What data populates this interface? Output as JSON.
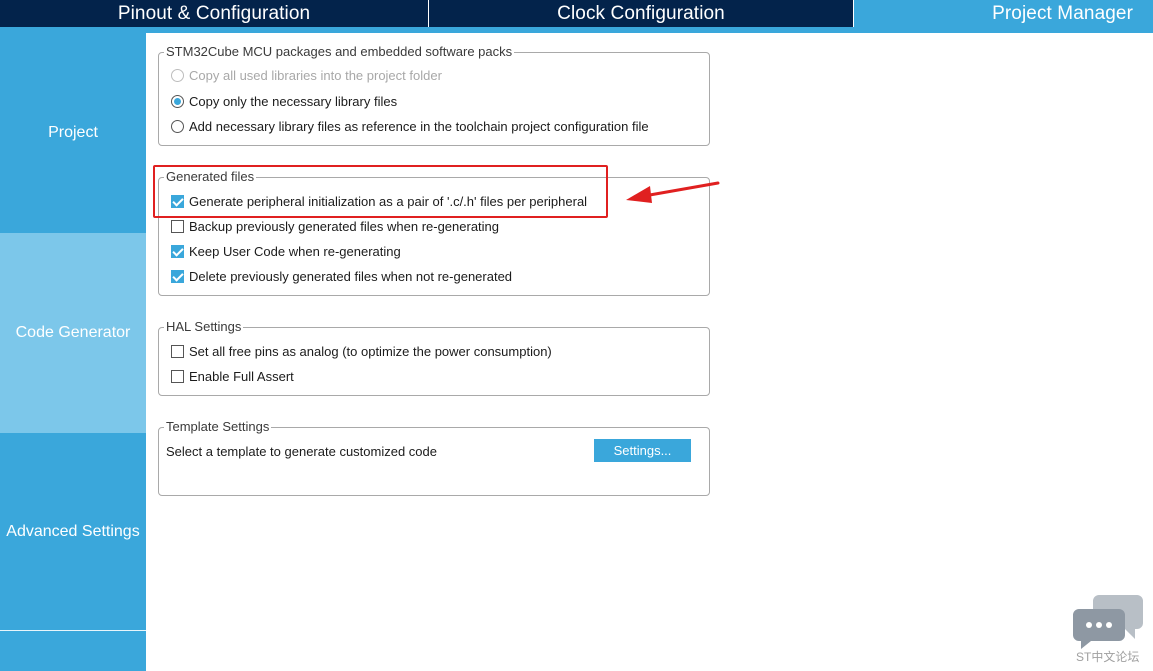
{
  "top_tabs": {
    "pinout": "Pinout & Configuration",
    "clock": "Clock Configuration",
    "project_manager": "Project Manager"
  },
  "sidebar": {
    "items": [
      {
        "label": "Project"
      },
      {
        "label": "Code Generator"
      },
      {
        "label": "Advanced Settings"
      }
    ]
  },
  "groups": {
    "packages": {
      "title": "STM32Cube MCU packages and embedded software packs",
      "options": [
        {
          "label": "Copy all used libraries into the project folder",
          "state": "disabled"
        },
        {
          "label": "Copy only the necessary library files",
          "state": "selected"
        },
        {
          "label": "Add necessary library files as reference in the toolchain project configuration file",
          "state": "unselected"
        }
      ]
    },
    "generated": {
      "title": "Generated files",
      "options": [
        {
          "label": "Generate peripheral initialization as a pair of '.c/.h' files per peripheral",
          "checked": true
        },
        {
          "label": "Backup previously generated files when re-generating",
          "checked": false
        },
        {
          "label": "Keep User Code when re-generating",
          "checked": true
        },
        {
          "label": "Delete previously generated files when not re-generated",
          "checked": true
        }
      ]
    },
    "hal": {
      "title": "HAL Settings",
      "options": [
        {
          "label": "Set all free pins as analog (to optimize the power consumption)",
          "checked": false
        },
        {
          "label": "Enable Full Assert",
          "checked": false
        }
      ]
    },
    "template": {
      "title": "Template Settings",
      "description": "Select a template to generate customized code",
      "button": "Settings..."
    }
  },
  "annotation": {
    "color": "#e02020"
  },
  "watermark": {
    "text": "ST中文论坛",
    "icon": "chat-bubbles-icon"
  },
  "colors": {
    "header_dark": "#03234b",
    "accent": "#3aa7db",
    "sidebar_active": "#7cc7ea"
  }
}
